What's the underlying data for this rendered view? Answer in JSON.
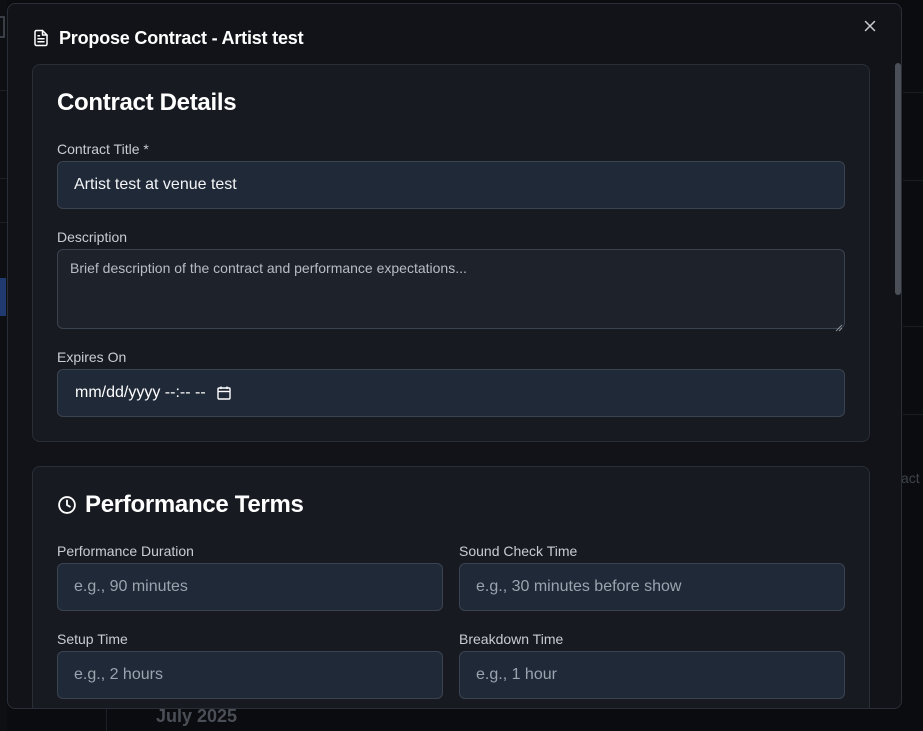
{
  "modal": {
    "title": "Propose Contract - Artist test",
    "close_label": "×"
  },
  "contract_details": {
    "heading": "Contract Details",
    "title_label": "Contract Title *",
    "title_value": "Artist test at venue test",
    "description_label": "Description",
    "description_placeholder": "Brief description of the contract and performance expectations...",
    "expires_label": "Expires On",
    "expires_value": "mm/dd/yyyy --:-- --"
  },
  "performance_terms": {
    "heading": "Performance Terms",
    "duration_label": "Performance Duration",
    "duration_placeholder": "e.g., 90 minutes",
    "soundcheck_label": "Sound Check Time",
    "soundcheck_placeholder": "e.g., 30 minutes before show",
    "setup_label": "Setup Time",
    "setup_placeholder": "e.g., 2 hours",
    "breakdown_label": "Breakdown Time",
    "breakdown_placeholder": "e.g., 1 hour"
  },
  "background": {
    "right_text": "act",
    "bottom_text": "July 2025"
  },
  "icons": {
    "header": "document-icon",
    "performance": "clock-icon",
    "date": "calendar-icon",
    "close": "close-icon"
  }
}
